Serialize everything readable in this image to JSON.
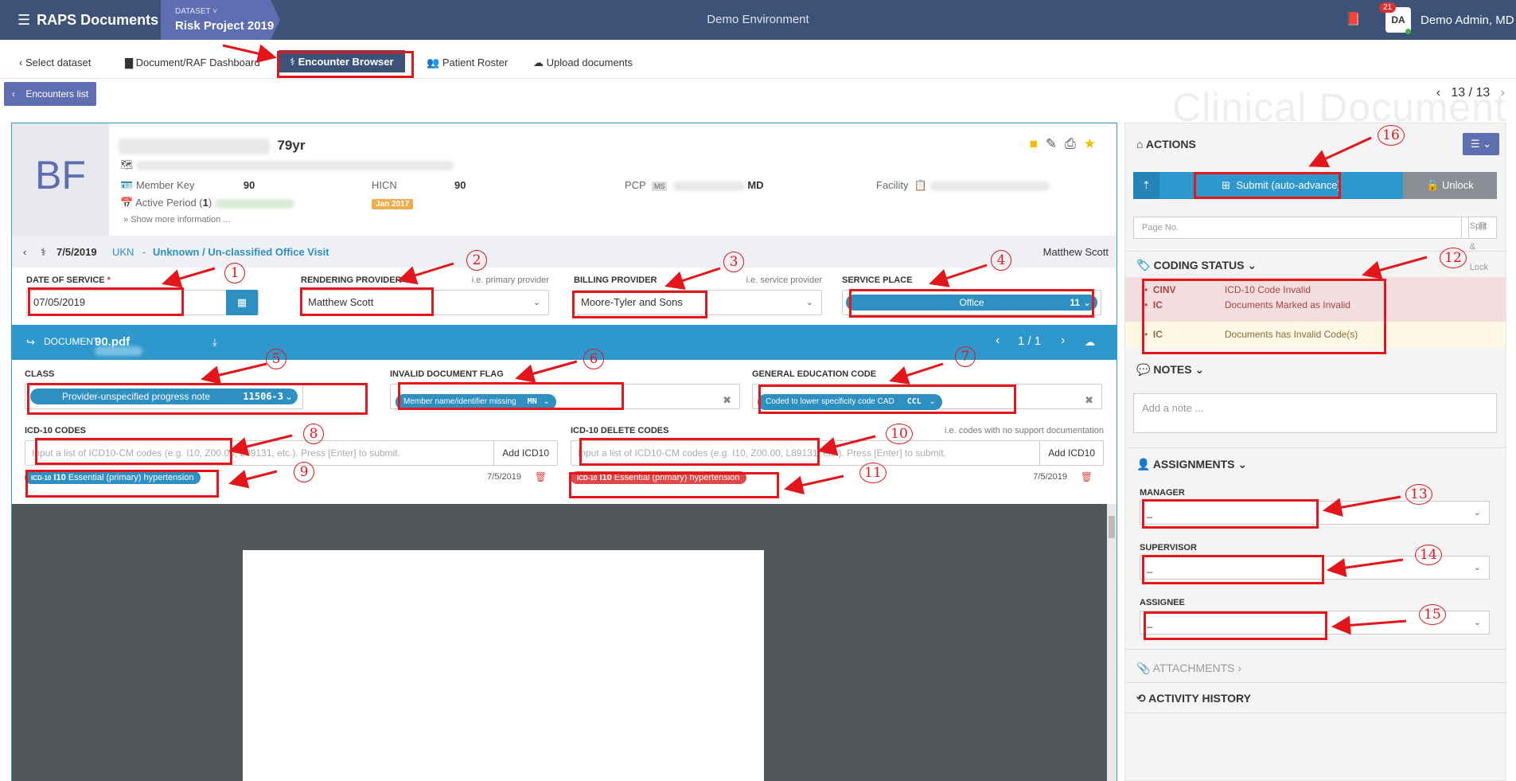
{
  "topbar": {
    "brand": "RAPS Documents",
    "dataset_label": "DATASET ˅",
    "dataset_value": "Risk Project 2019",
    "environment": "Demo Environment",
    "notif_count": "21",
    "avatar_initials": "DA",
    "user_name": "Demo Admin, MD"
  },
  "nav": {
    "select_dataset": "Select dataset",
    "dashboard": "Document/RAF Dashboard",
    "encounter_browser": "Encounter Browser",
    "patient_roster": "Patient Roster",
    "upload": "Upload documents",
    "watermark": "Clinical Document"
  },
  "encounters": {
    "button": "Encounters list",
    "pager": "13 / 13"
  },
  "patient": {
    "initials": "BF",
    "age": "79yr",
    "member_key_label": "Member Key",
    "member_key": "90",
    "hicn_label": "HICN",
    "hicn": "90",
    "pcp_label": "PCP",
    "pcp_badge": "MS",
    "pcp_suffix": "MD",
    "facility_label": "Facility",
    "active_period_label": "Active Period (",
    "active_period_count": "1",
    "active_period_close": ")",
    "period_badge": "Jan 2017",
    "show_more": "Show more information ..."
  },
  "visit": {
    "date": "7/5/2019",
    "code": "UKN",
    "dash": "-",
    "type": "Unknown / Un-classified Office Visit",
    "provider": "Matthew Scott"
  },
  "fields": {
    "dos_label": "DATE OF SERVICE",
    "dos_required": "*",
    "dos_value": "07/05/2019",
    "rendering_label": "RENDERING PROVIDER",
    "rendering_hint": "i.e. primary provider",
    "rendering_value": "Matthew Scott",
    "billing_label": "BILLING PROVIDER",
    "billing_hint": "i.e. service provider",
    "billing_value": "Moore-Tyler and Sons",
    "place_label": "SERVICE PLACE",
    "place_value": "Office",
    "place_code": "11"
  },
  "document": {
    "label": "DOCUMENT",
    "file_suffix": "90.pdf",
    "pager": "1 / 1"
  },
  "doc_fields": {
    "class_label": "CLASS",
    "class_value": "Provider-unspecified progress note",
    "class_code": "11506-3",
    "invalid_label": "INVALID DOCUMENT FLAG",
    "invalid_value": "Member name/identifier missing",
    "invalid_code": "MN",
    "gec_label": "GENERAL EDUCATION CODE",
    "gec_value": "Coded to lower specificity code CAD",
    "gec_code": "CCL"
  },
  "icd": {
    "codes_label": "ICD-10 CODES",
    "placeholder": "Input a list of ICD10-CM codes (e.g. I10, Z00.00, L89131, etc.). Press [Enter] to submit.",
    "add_label": "Add ICD10",
    "delete_label": "ICD-10 DELETE CODES",
    "delete_hint": "i.e. codes with no support documentation",
    "pill_prefix": "ICD-10",
    "pill_code": "I10",
    "pill_text": "Essential (primary) hypertension",
    "pill_date": "7/5/2019"
  },
  "actions": {
    "title": "ACTIONS",
    "submit": "Submit  (auto-advance)",
    "unlock": "Unlock",
    "page_no_placeholder": "Page No.",
    "split_lock": "Split & Lock"
  },
  "coding_status": {
    "title": "CODING STATUS",
    "rows": [
      {
        "code": "CINV",
        "text": "ICD-10 Code Invalid"
      },
      {
        "code": "IC",
        "text": "Documents Marked as Invalid"
      },
      {
        "code": "IC",
        "text": "Documents has Invalid Code(s)"
      }
    ]
  },
  "notes": {
    "title": "NOTES",
    "placeholder": "Add a note ..."
  },
  "assignments": {
    "title": "ASSIGNMENTS",
    "manager": "MANAGER",
    "supervisor": "SUPERVISOR",
    "assignee": "ASSIGNEE",
    "empty": "_"
  },
  "attachments": {
    "title": "ATTACHMENTS"
  },
  "history": {
    "title": "ACTIVITY HISTORY"
  },
  "annotations": [
    "1",
    "2",
    "3",
    "4",
    "5",
    "6",
    "7",
    "8",
    "9",
    "10",
    "11",
    "12",
    "13",
    "14",
    "15",
    "16"
  ]
}
